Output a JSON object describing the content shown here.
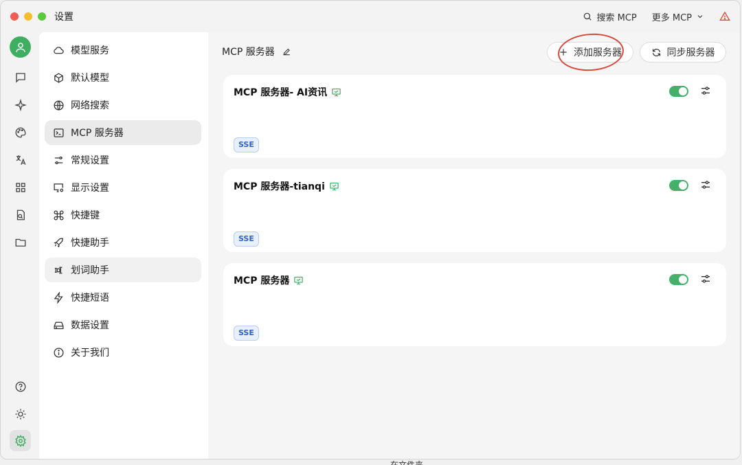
{
  "window": {
    "title": "设置"
  },
  "titlebar": {
    "search_label": "搜索 MCP",
    "more_label": "更多 MCP"
  },
  "nav": {
    "items": [
      {
        "label": "模型服务",
        "icon": "cloud-icon"
      },
      {
        "label": "默认模型",
        "icon": "cube-icon"
      },
      {
        "label": "网络搜索",
        "icon": "globe-icon"
      },
      {
        "label": "MCP 服务器",
        "icon": "terminal-icon"
      },
      {
        "label": "常规设置",
        "icon": "settings-sliders-icon"
      },
      {
        "label": "显示设置",
        "icon": "monitor-settings-icon"
      },
      {
        "label": "快捷键",
        "icon": "command-icon"
      },
      {
        "label": "快捷助手",
        "icon": "rocket-icon"
      },
      {
        "label": "划词助手",
        "icon": "text-select-icon"
      },
      {
        "label": "快捷短语",
        "icon": "zap-icon"
      },
      {
        "label": "数据设置",
        "icon": "hard-drive-icon"
      },
      {
        "label": "关于我们",
        "icon": "info-icon"
      }
    ]
  },
  "main": {
    "title": "MCP 服务器",
    "add_button": "添加服务器",
    "sync_button": "同步服务器",
    "servers": [
      {
        "name": "MCP 服务器- AI资讯",
        "type": "SSE",
        "enabled": true
      },
      {
        "name": "MCP 服务器-tianqi",
        "type": "SSE",
        "enabled": true
      },
      {
        "name": "MCP 服务器",
        "type": "SSE",
        "enabled": true
      }
    ]
  },
  "footer_text": "在文件夹",
  "colors": {
    "accent": "#45b069",
    "badge": "#2f63c4",
    "annotation": "#d9473b"
  }
}
